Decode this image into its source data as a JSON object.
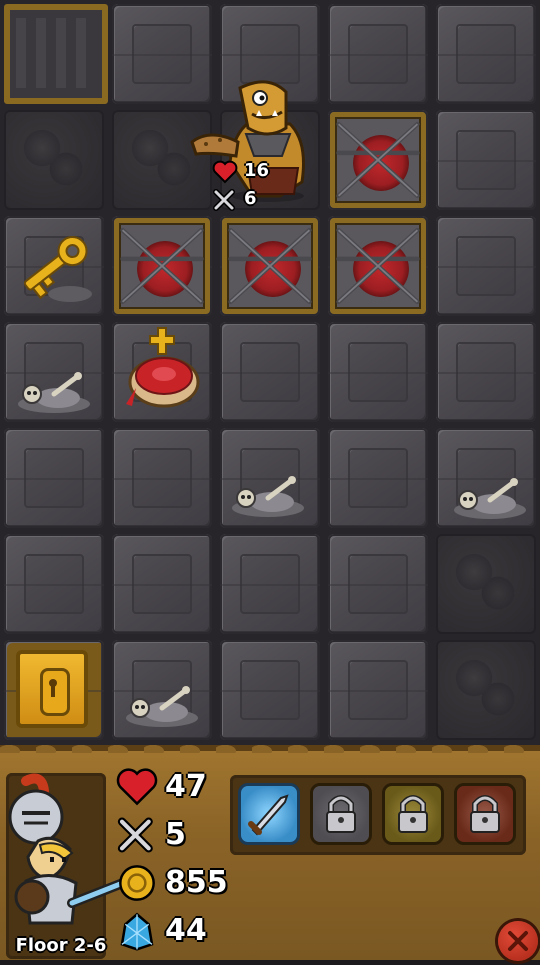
{
  "board": {
    "enemy": {
      "name_icon": "ogre-with-club-icon",
      "hp": "16",
      "attack": "6"
    },
    "items": [
      "golden-key-icon",
      "blood-altar-icon",
      "locked-door-icon"
    ],
    "blocked_tiles": "chained-crate-icon"
  },
  "hero": {
    "floor_label": "Floor 2-6",
    "hp": "47",
    "attack": "5",
    "gold": "855",
    "gems": "44"
  },
  "skills": [
    {
      "icon": "sword-skill-icon",
      "locked": false
    },
    {
      "icon": "padlock-icon",
      "locked": true
    },
    {
      "icon": "padlock-icon",
      "locked": true
    },
    {
      "icon": "padlock-icon",
      "locked": true
    }
  ],
  "colors": {
    "hp": "#d8202a",
    "gold": "#e8b21c",
    "gem": "#3aa8e0",
    "frame": "#8b6b22"
  }
}
